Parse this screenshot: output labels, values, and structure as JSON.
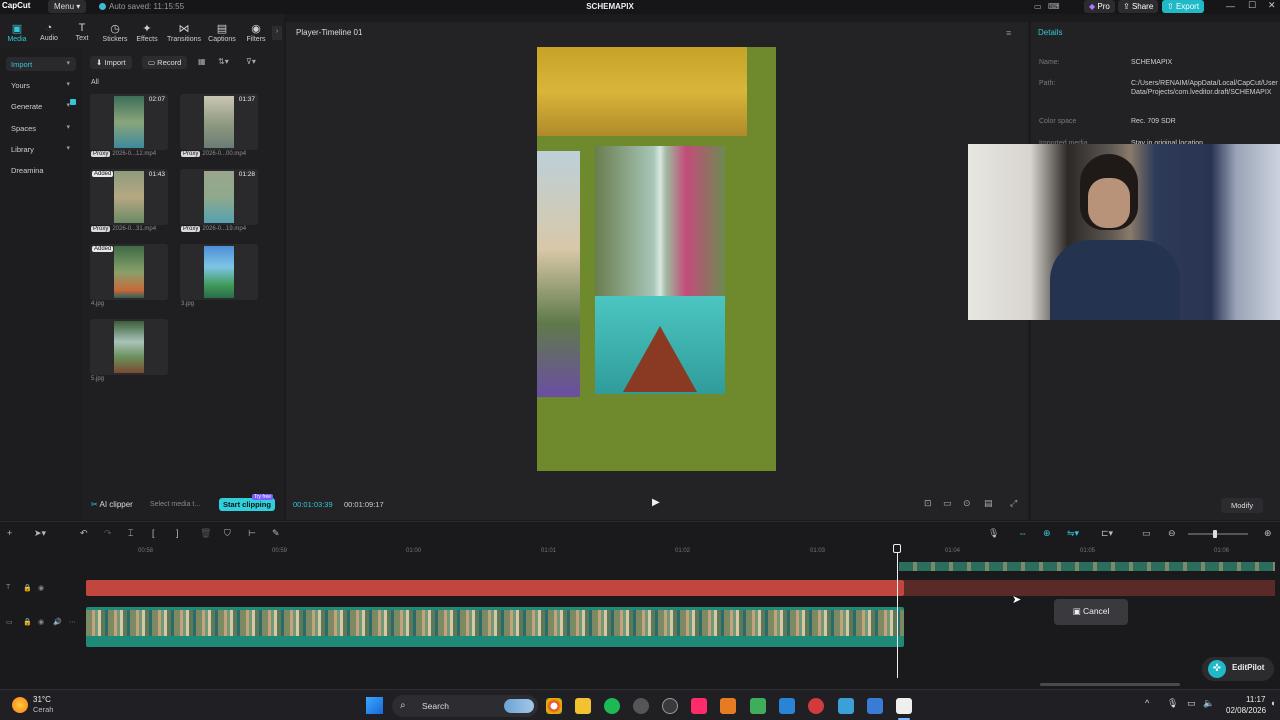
{
  "titlebar": {
    "app_name": "CapCut",
    "menu_label": "Menu",
    "autosave": "Auto saved: 11:15:55",
    "project_title": "SCHEMAPIX",
    "pro_label": "Pro",
    "share_label": "Share",
    "export_label": "Export"
  },
  "toolbar": {
    "tools": [
      {
        "label": "Media",
        "icon": "media-icon"
      },
      {
        "label": "Audio",
        "icon": "audio-icon"
      },
      {
        "label": "Text",
        "icon": "text-icon"
      },
      {
        "label": "Stickers",
        "icon": "stickers-icon"
      },
      {
        "label": "Effects",
        "icon": "effects-icon"
      },
      {
        "label": "Transitions",
        "icon": "transitions-icon"
      },
      {
        "label": "Captions",
        "icon": "captions-icon"
      },
      {
        "label": "Filters",
        "icon": "filters-icon"
      }
    ]
  },
  "sidebar": {
    "items": [
      {
        "label": "Import"
      },
      {
        "label": "Yours"
      },
      {
        "label": "Generate"
      },
      {
        "label": "Spaces"
      },
      {
        "label": "Library"
      },
      {
        "label": "Dreamina"
      }
    ]
  },
  "media": {
    "import_label": "Import",
    "record_label": "Record",
    "filter_label": "All",
    "items": [
      {
        "duration": "02:07",
        "badge": "",
        "proxy": "Proxy",
        "name": "2026-0...12.mp4"
      },
      {
        "duration": "01:37",
        "badge": "",
        "proxy": "Proxy",
        "name": "2026-0...00.mp4"
      },
      {
        "duration": "01:43",
        "badge": "Added",
        "proxy": "Proxy",
        "name": "2026-0...31.mp4"
      },
      {
        "duration": "01:28",
        "badge": "",
        "proxy": "Proxy",
        "name": "2026-0...19.mp4"
      },
      {
        "duration": "",
        "badge": "Added",
        "proxy": "",
        "name": "4.jpg"
      },
      {
        "duration": "",
        "badge": "",
        "proxy": "",
        "name": "3.jpg"
      },
      {
        "duration": "",
        "badge": "",
        "proxy": "",
        "name": "5.jpg"
      }
    ],
    "ai_clipper_label": "AI clipper",
    "select_media_hint": "Select media t...",
    "start_clipping_label": "Start clipping",
    "try_free_label": "Try free"
  },
  "player": {
    "title": "Player-Timeline 01",
    "current_time": "00:01:03:39",
    "total_time": "00:01:09:17"
  },
  "details": {
    "header": "Details",
    "rows": [
      {
        "label": "Name:",
        "value": "SCHEMAPIX"
      },
      {
        "label": "Path:",
        "value": "C:/Users/RENAIM/AppData/Local/CapCut/User Data/Projects/com.lveditor.draft/SCHEMAPIX"
      },
      {
        "label": "Color space",
        "value": "Rec. 709 SDR"
      },
      {
        "label": "Imported media",
        "value": "Stay in original location"
      }
    ],
    "modify_label": "Modify"
  },
  "timeline": {
    "ruler_marks": [
      "00:58",
      "00:59",
      "01:00",
      "01:01",
      "01:02",
      "01:03",
      "01:04",
      "01:05",
      "01:06"
    ],
    "cancel_label": "Cancel",
    "editpilot_label": "EditPilot",
    "progress_played": 0.69
  },
  "taskbar": {
    "weather_temp": "31°C",
    "weather_desc": "Cerah",
    "search_label": "Search",
    "time": "11:17",
    "date": "02/08/2026"
  },
  "colors": {
    "accent": "#33c7d6",
    "audio_track": "#c0463e",
    "video_track": "#1f8a7a",
    "export": "#1fb9c8"
  }
}
